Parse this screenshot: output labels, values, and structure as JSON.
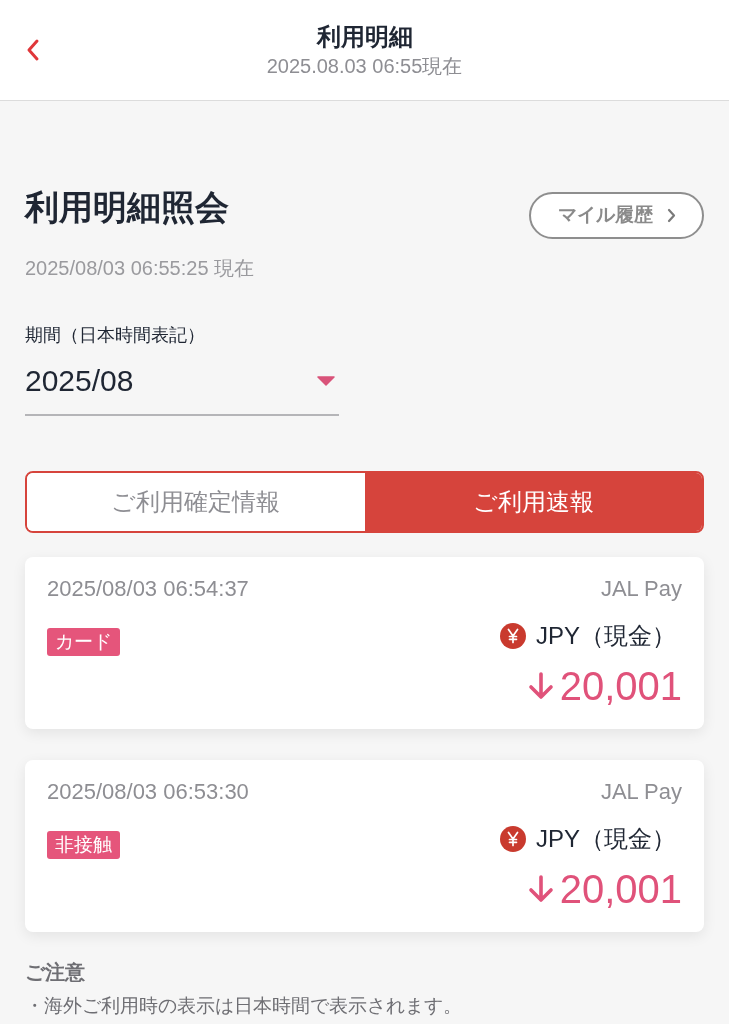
{
  "header": {
    "title": "利用明細",
    "subtitle": "2025.08.03 06:55現在"
  },
  "page": {
    "title": "利用明細照会",
    "timestamp": "2025/08/03 06:55:25 現在",
    "mile_history_button": "マイル履歴"
  },
  "period": {
    "label": "期間（日本時間表記）",
    "value": "2025/08"
  },
  "tabs": [
    {
      "label": "ご利用確定情報",
      "selected": false
    },
    {
      "label": "ご利用速報",
      "selected": true
    }
  ],
  "transactions": [
    {
      "datetime": "2025/08/03 06:54:37",
      "service": "JAL Pay",
      "type": "カード",
      "currency": "JPY（現金）",
      "amount": "20,001"
    },
    {
      "datetime": "2025/08/03 06:53:30",
      "service": "JAL Pay",
      "type": "非接触",
      "currency": "JPY（現金）",
      "amount": "20,001"
    }
  ],
  "notice": {
    "title": "ご注意",
    "items": [
      "・海外ご利用時の表示は日本時間で表示されます。"
    ]
  }
}
